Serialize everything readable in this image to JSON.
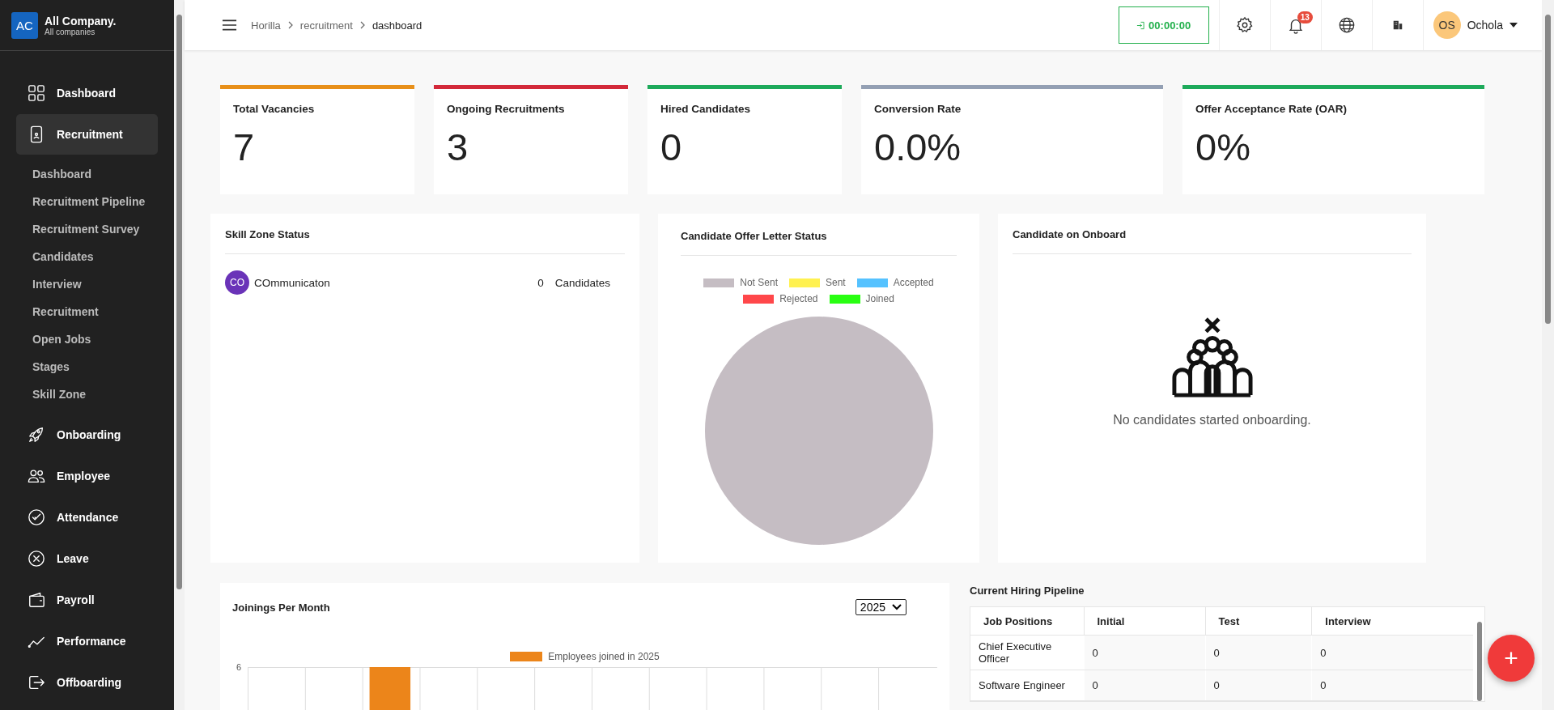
{
  "company": {
    "initials": "AC",
    "name": "All Company.",
    "subtitle": "All companies"
  },
  "sidebar": {
    "items": [
      {
        "label": "Dashboard",
        "selected": false
      },
      {
        "label": "Recruitment",
        "selected": true,
        "expanded": true,
        "children": [
          {
            "label": "Dashboard"
          },
          {
            "label": "Recruitment Pipeline"
          },
          {
            "label": "Recruitment Survey"
          },
          {
            "label": "Candidates"
          },
          {
            "label": "Interview"
          },
          {
            "label": "Recruitment"
          },
          {
            "label": "Open Jobs"
          },
          {
            "label": "Stages"
          },
          {
            "label": "Skill Zone"
          }
        ]
      },
      {
        "label": "Onboarding",
        "selected": false
      },
      {
        "label": "Employee",
        "selected": false
      },
      {
        "label": "Attendance",
        "selected": false
      },
      {
        "label": "Leave",
        "selected": false
      },
      {
        "label": "Payroll",
        "selected": false
      },
      {
        "label": "Performance",
        "selected": false
      },
      {
        "label": "Offboarding",
        "selected": false
      }
    ]
  },
  "header": {
    "breadcrumb": [
      "Horilla",
      "recruitment",
      "dashboard"
    ],
    "timer": "00:00:00",
    "notifications": "13",
    "user": {
      "initials": "OS",
      "name": "Ochola"
    }
  },
  "stats": [
    {
      "label": "Total Vacancies",
      "value": "7",
      "color": "#e8901a"
    },
    {
      "label": "Ongoing Recruitments",
      "value": "3",
      "color": "#d3293a"
    },
    {
      "label": "Hired Candidates",
      "value": "0",
      "color": "#1eaa5b"
    },
    {
      "label": "Conversion Rate",
      "value": "0.0%",
      "color": "#94a0b4"
    },
    {
      "label": "Offer Acceptance Rate (OAR)",
      "value": "0%",
      "color": "#1eaa5b"
    }
  ],
  "skill_zone": {
    "title": "Skill Zone Status",
    "items": [
      {
        "initials": "CO",
        "name": "COmmunicaton",
        "count": "0",
        "unit": "Candidates"
      }
    ]
  },
  "offer_letter": {
    "title": "Candidate Offer Letter Status",
    "chart_data": {
      "type": "pie",
      "categories": [
        "Not Sent",
        "Sent",
        "Accepted",
        "Rejected",
        "Joined"
      ],
      "series": [
        {
          "colors": [
            "#c5bdc3",
            "#fff150",
            "#55c2ff",
            "#ff474a",
            "#29ff12"
          ],
          "values": [
            1,
            0,
            0,
            0,
            0
          ]
        }
      ]
    }
  },
  "onboard": {
    "title": "Candidate on Onboard",
    "empty_text": "No candidates started onboarding."
  },
  "joinings": {
    "title": "Joinings Per Month",
    "year": "2025",
    "legend": {
      "label": "Employees joined in 2025",
      "color": "#ec851a"
    },
    "y_tick": "6"
  },
  "pipeline": {
    "title": "Current Hiring Pipeline",
    "columns": [
      "Job Positions",
      "Initial",
      "Test",
      "Interview"
    ],
    "rows": [
      [
        "Chief Executive Officer",
        "0",
        "0",
        "0"
      ],
      [
        "Software Engineer",
        "0",
        "0",
        "0"
      ]
    ]
  },
  "fab": {
    "label": "+"
  }
}
